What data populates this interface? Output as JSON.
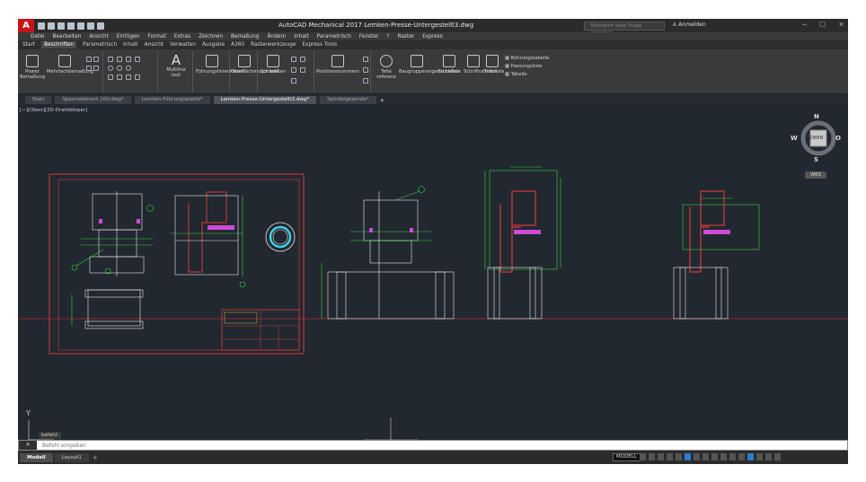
{
  "app": {
    "title": "AutoCAD Mechanical 2017   Lemken-Presse-Untergestellt3.dwg",
    "logo": "A",
    "search_placeholder": "Stichwort oder Frage eingeben",
    "sign_in": "Anmelden",
    "win_minimize": "─",
    "win_restore": "☐",
    "win_close": "✕"
  },
  "menubar": [
    "Datei",
    "Bearbeiten",
    "Ansicht",
    "Einfügen",
    "Format",
    "Extras",
    "Zeichnen",
    "Bemaßung",
    "Ändern",
    "Inhalt",
    "Parametrisch",
    "Fenster",
    "?",
    "Raster",
    "Express"
  ],
  "ribbon_tabs": [
    "Start",
    "Beschriften",
    "Parametrisch",
    "Inhalt",
    "Ansicht",
    "Verwalten",
    "Ausgabe",
    "A360",
    "Rasterwerkzeuge",
    "Express Tools"
  ],
  "ribbon_active_tab": "Beschriften",
  "ribbon": {
    "power_dim": "Power Bemaßung",
    "multi_dim": "Mehrfachbemaßung",
    "multiline_text": "Multiline text",
    "leader": "Führungslinienkomm",
    "surface": "Oberflächensymbole",
    "weld": "Schweißen",
    "position": "Positionsnummern",
    "parts_ref": "Teile referenz",
    "assembly": "Baugruppeneigenschaften",
    "parts_list": "Stückliste",
    "font_frame": "Schriftrahmen",
    "parts_table": "Teileliste",
    "bore_table": "Bohrungstabelle",
    "fit_list": "Passungsliste",
    "table": "Tabelle"
  },
  "doc_tabs": [
    "Start",
    "Spannelement 100.dwg*",
    "Lemken-Führungsplatte*",
    "Lemken-Presse-Untergestellt3.dwg*",
    "Spindelgewinde*"
  ],
  "doc_active": "Lemken-Presse-Untergestellt3.dwg*",
  "doc_add": "+",
  "viewport_label": "[−][Oben][2D-Drahtkörper]",
  "viewcube": {
    "n": "N",
    "s": "S",
    "w": "W",
    "o": "O",
    "face": "OBEN",
    "wcs": "WKS"
  },
  "command": {
    "history": "befehl:",
    "placeholder": "Befehl eingeben",
    "close": "✕"
  },
  "statusbar": {
    "tabs": [
      "Modell",
      "Layout1"
    ],
    "active_tab": "Modell",
    "add": "+",
    "model_button": "MODELL"
  },
  "colors": {
    "background": "#212830",
    "drawing_green": "#3dd23d",
    "drawing_red": "#d83a3a",
    "drawing_white": "#e8e8e8",
    "drawing_yellow": "#e8e84a",
    "drawing_cyan": "#40d0e0",
    "drawing_magenta": "#d04ad8"
  }
}
